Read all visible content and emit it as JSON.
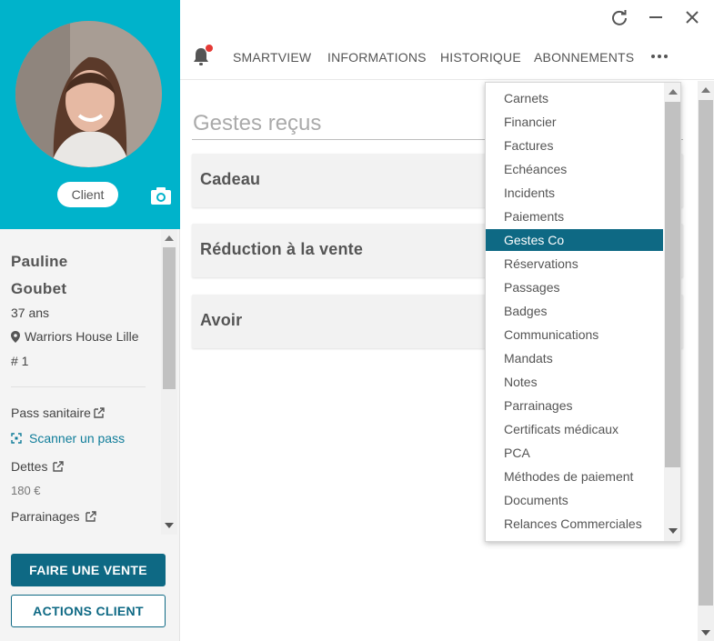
{
  "profile": {
    "badge": "Client",
    "first_name": "Pauline",
    "last_name": "Goubet",
    "age": "37 ans",
    "location": "Warriors House Lille",
    "member_number": "# 1",
    "pass_label": "Pass sanitaire",
    "scan_label": "Scanner un pass",
    "dettes_label": "Dettes",
    "dettes_value": "180 €",
    "parrainages_label": "Parrainages"
  },
  "buttons": {
    "sale": "FAIRE UNE VENTE",
    "actions": "ACTIONS CLIENT"
  },
  "nav": {
    "tabs": [
      "SMARTVIEW",
      "INFORMATIONS",
      "HISTORIQUE",
      "ABONNEMENTS"
    ]
  },
  "main": {
    "section_title": "Gestes reçus",
    "cards": [
      "Cadeau",
      "Réduction à la vente",
      "Avoir"
    ]
  },
  "menu": {
    "items": [
      "Carnets",
      "Financier",
      "Factures",
      "Echéances",
      "Incidents",
      "Paiements",
      "Gestes Co",
      "Réservations",
      "Passages",
      "Badges",
      "Communications",
      "Mandats",
      "Notes",
      "Parrainages",
      "Certificats médicaux",
      "PCA",
      "Méthodes de paiement",
      "Documents",
      "Relances Commerciales"
    ],
    "selected": "Gestes Co"
  },
  "colors": {
    "header_bg": "#00b3cb",
    "primary": "#0e6984",
    "notification": "#e53935"
  }
}
